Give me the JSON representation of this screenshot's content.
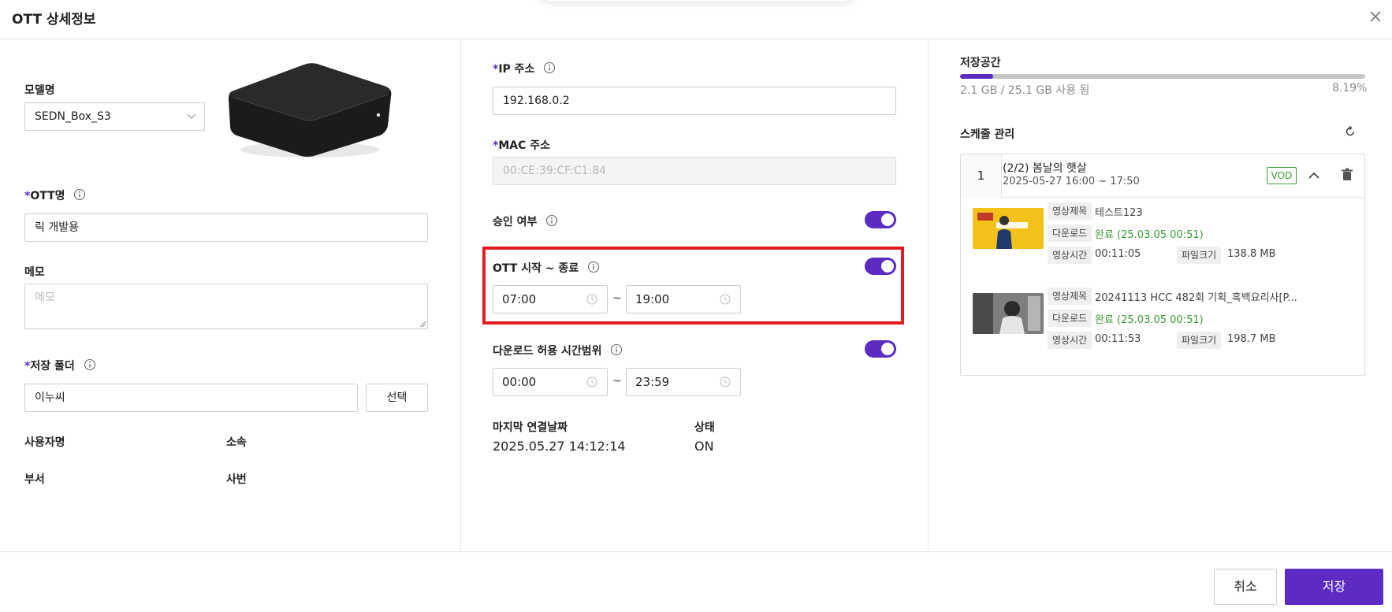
{
  "modal": {
    "title": "OTT 상세정보",
    "close_icon": "close-icon"
  },
  "left": {
    "model": {
      "label": "모델명",
      "value": "SEDN_Box_S3"
    },
    "ott_name": {
      "required": "*",
      "label": "OTT명",
      "value": "릭 개발용"
    },
    "memo": {
      "label": "메모",
      "placeholder": "메모"
    },
    "folder": {
      "required": "*",
      "label": "저장 폴더",
      "value": "이누씨",
      "select_button": "선택"
    },
    "user_name_label": "사용자명",
    "affiliation_label": "소속",
    "department_label": "부서",
    "employee_no_label": "사번"
  },
  "middle": {
    "ip": {
      "required": "*",
      "label": "IP 주소",
      "value": "192.168.0.2"
    },
    "mac": {
      "required": "*",
      "label": "MAC 주소",
      "value": "00:CE:39:CF:C1:84"
    },
    "approval": {
      "label": "승인 여부",
      "on": true
    },
    "ott_time": {
      "label": "OTT 시작 ~ 종료",
      "on": true,
      "start": "07:00",
      "tilde": "~",
      "end": "19:00"
    },
    "download_time": {
      "label": "다운로드 허용 시간범위",
      "on": true,
      "start": "00:00",
      "tilde": "~",
      "end": "23:59"
    },
    "last_connection": {
      "label": "마지막 연결날짜",
      "value": "2025.05.27 14:12:14"
    },
    "status": {
      "label": "상태",
      "value": "ON"
    }
  },
  "right": {
    "storage": {
      "label": "저장공간",
      "usage_text": "2.1 GB / 25.1 GB 사용 됨",
      "percent_text": "8.19%",
      "fraction": 0.0819
    },
    "schedule": {
      "label": "스케줄 관리",
      "refresh_icon": "refresh-icon",
      "items": [
        {
          "index": "1",
          "title": "(2/2) 봄날의 햇살",
          "time": "2025-05-27 16:00 ~ 17:50",
          "badge": "VOD",
          "videos": [
            {
              "title_tag": "영상제목",
              "title": "테스트123",
              "download_tag": "다운로드",
              "download": "완료 (25.03.05 00:51)",
              "duration_tag": "영상시간",
              "duration": "00:11:05",
              "size_tag": "파일크기",
              "size": "138.8 MB"
            },
            {
              "title_tag": "영상제목",
              "title": "20241113 HCC 482회 기획_흑백요리사[P...",
              "download_tag": "다운로드",
              "download": "완료 (25.03.05 00:51)",
              "duration_tag": "영상시간",
              "duration": "00:11:53",
              "size_tag": "파일크기",
              "size": "198.7 MB"
            }
          ]
        }
      ]
    }
  },
  "footer": {
    "cancel": "취소",
    "save": "저장"
  },
  "colors": {
    "accent": "#5b2bc2",
    "success": "#3a9b33",
    "highlight": "#e31c23"
  }
}
